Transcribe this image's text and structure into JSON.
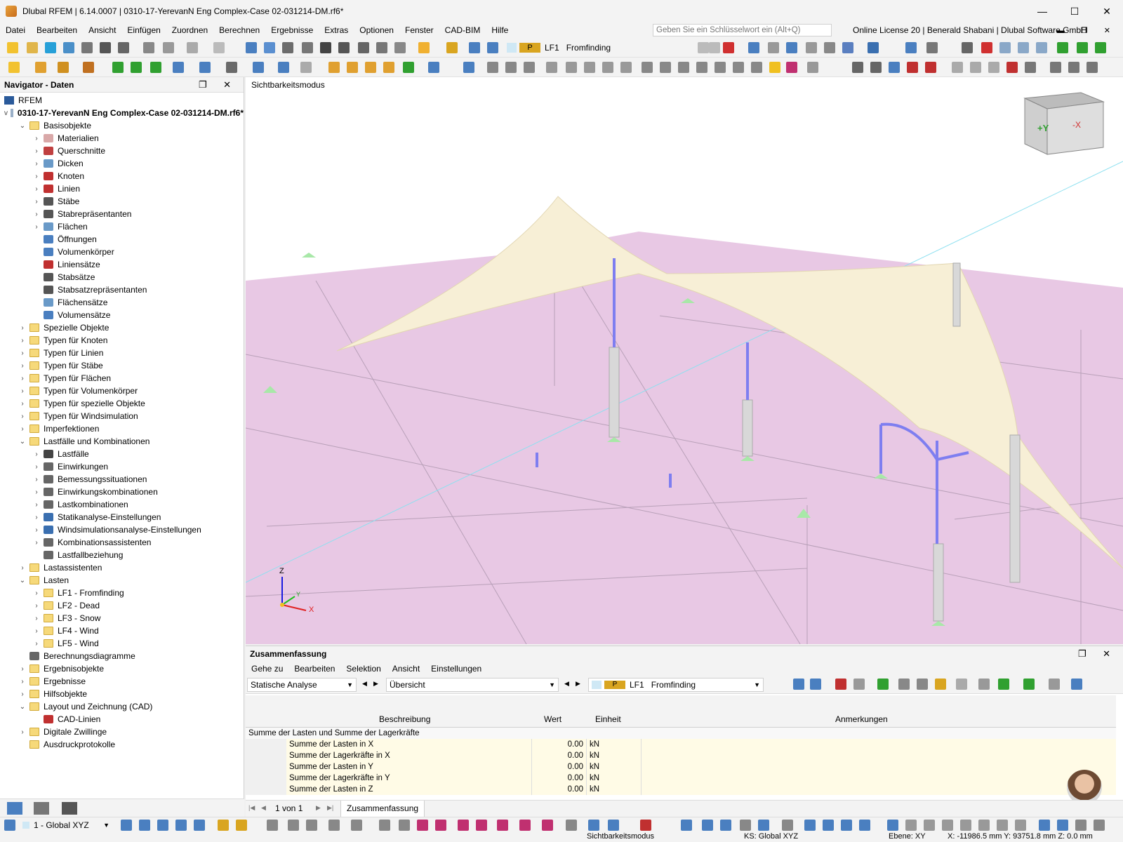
{
  "window": {
    "title": "Dlubal RFEM | 6.14.0007 | 0310-17-YerevanN Eng Complex-Case 02-031214-DM.rf6*",
    "buttons": [
      "—",
      "☐",
      "✕"
    ]
  },
  "menu": {
    "items": [
      "Datei",
      "Bearbeiten",
      "Ansicht",
      "Einfügen",
      "Zuordnen",
      "Berechnen",
      "Ergebnisse",
      "Extras",
      "Optionen",
      "Fenster",
      "CAD-BIM",
      "Hilfe"
    ],
    "search_placeholder": "Geben Sie ein Schlüsselwort ein (Alt+Q)",
    "license": "Online License 20 | Benerald Shabani | Dlubal Software GmbH"
  },
  "toolbar": {
    "loadcase_badge": "P",
    "loadcase_id": "LF1",
    "loadcase_name": "Fromfinding"
  },
  "navigator": {
    "title": "Navigator - Daten",
    "root": "RFEM",
    "file": "0310-17-YerevanN Eng Complex-Case 02-031214-DM.rf6*",
    "items": [
      {
        "label": "Basisobjekte",
        "level": 1,
        "toggle": "v",
        "icon": "folder"
      },
      {
        "label": "Materialien",
        "level": 2,
        "toggle": ">",
        "icon": "material"
      },
      {
        "label": "Querschnitte",
        "level": 2,
        "toggle": ">",
        "icon": "section"
      },
      {
        "label": "Dicken",
        "level": 2,
        "toggle": ">",
        "icon": "thickness"
      },
      {
        "label": "Knoten",
        "level": 2,
        "toggle": ">",
        "icon": "node"
      },
      {
        "label": "Linien",
        "level": 2,
        "toggle": ">",
        "icon": "line"
      },
      {
        "label": "Stäbe",
        "level": 2,
        "toggle": ">",
        "icon": "member"
      },
      {
        "label": "Stabrepräsentanten",
        "level": 2,
        "toggle": ">",
        "icon": "member"
      },
      {
        "label": "Flächen",
        "level": 2,
        "toggle": ">",
        "icon": "surface"
      },
      {
        "label": "Öffnungen",
        "level": 2,
        "toggle": "",
        "icon": "opening"
      },
      {
        "label": "Volumenkörper",
        "level": 2,
        "toggle": "",
        "icon": "solid"
      },
      {
        "label": "Liniensätze",
        "level": 2,
        "toggle": "",
        "icon": "line"
      },
      {
        "label": "Stabsätze",
        "level": 2,
        "toggle": "",
        "icon": "member"
      },
      {
        "label": "Stabsatzrepräsentanten",
        "level": 2,
        "toggle": "",
        "icon": "member"
      },
      {
        "label": "Flächensätze",
        "level": 2,
        "toggle": "",
        "icon": "surface"
      },
      {
        "label": "Volumensätze",
        "level": 2,
        "toggle": "",
        "icon": "solid"
      },
      {
        "label": "Spezielle Objekte",
        "level": 1,
        "toggle": ">",
        "icon": "folder"
      },
      {
        "label": "Typen für Knoten",
        "level": 1,
        "toggle": ">",
        "icon": "folder"
      },
      {
        "label": "Typen für Linien",
        "level": 1,
        "toggle": ">",
        "icon": "folder"
      },
      {
        "label": "Typen für Stäbe",
        "level": 1,
        "toggle": ">",
        "icon": "folder"
      },
      {
        "label": "Typen für Flächen",
        "level": 1,
        "toggle": ">",
        "icon": "folder"
      },
      {
        "label": "Typen für Volumenkörper",
        "level": 1,
        "toggle": ">",
        "icon": "folder"
      },
      {
        "label": "Typen für spezielle Objekte",
        "level": 1,
        "toggle": ">",
        "icon": "folder"
      },
      {
        "label": "Typen für Windsimulation",
        "level": 1,
        "toggle": ">",
        "icon": "folder"
      },
      {
        "label": "Imperfektionen",
        "level": 1,
        "toggle": ">",
        "icon": "folder"
      },
      {
        "label": "Lastfälle und Kombinationen",
        "level": 1,
        "toggle": "v",
        "icon": "folder"
      },
      {
        "label": "Lastfälle",
        "level": 2,
        "toggle": ">",
        "icon": "loadcase"
      },
      {
        "label": "Einwirkungen",
        "level": 2,
        "toggle": ">",
        "icon": "combo"
      },
      {
        "label": "Bemessungssituationen",
        "level": 2,
        "toggle": ">",
        "icon": "combo"
      },
      {
        "label": "Einwirkungskombinationen",
        "level": 2,
        "toggle": ">",
        "icon": "combo"
      },
      {
        "label": "Lastkombinationen",
        "level": 2,
        "toggle": ">",
        "icon": "combo"
      },
      {
        "label": "Statikanalyse-Einstellungen",
        "level": 2,
        "toggle": ">",
        "icon": "settings"
      },
      {
        "label": "Windsimulationsanalyse-Einstellungen",
        "level": 2,
        "toggle": ">",
        "icon": "settings"
      },
      {
        "label": "Kombinationsassistenten",
        "level": 2,
        "toggle": ">",
        "icon": "combo"
      },
      {
        "label": "Lastfallbeziehung",
        "level": 2,
        "toggle": "",
        "icon": "combo"
      },
      {
        "label": "Lastassistenten",
        "level": 1,
        "toggle": ">",
        "icon": "folder"
      },
      {
        "label": "Lasten",
        "level": 1,
        "toggle": "v",
        "icon": "folder"
      },
      {
        "label": "LF1 - Fromfinding",
        "level": 2,
        "toggle": ">",
        "icon": "folder"
      },
      {
        "label": "LF2 - Dead",
        "level": 2,
        "toggle": ">",
        "icon": "folder"
      },
      {
        "label": "LF3 - Snow",
        "level": 2,
        "toggle": ">",
        "icon": "folder"
      },
      {
        "label": "LF4 - Wind",
        "level": 2,
        "toggle": ">",
        "icon": "folder"
      },
      {
        "label": "LF5 - Wind",
        "level": 2,
        "toggle": ">",
        "icon": "folder"
      },
      {
        "label": "Berechnungsdiagramme",
        "level": 1,
        "toggle": "",
        "icon": "diagram"
      },
      {
        "label": "Ergebnisobjekte",
        "level": 1,
        "toggle": ">",
        "icon": "folder"
      },
      {
        "label": "Ergebnisse",
        "level": 1,
        "toggle": ">",
        "icon": "folder"
      },
      {
        "label": "Hilfsobjekte",
        "level": 1,
        "toggle": ">",
        "icon": "folder"
      },
      {
        "label": "Layout und Zeichnung (CAD)",
        "level": 1,
        "toggle": "v",
        "icon": "folder"
      },
      {
        "label": "CAD-Linien",
        "level": 2,
        "toggle": "",
        "icon": "line"
      },
      {
        "label": "Digitale Zwillinge",
        "level": 1,
        "toggle": ">",
        "icon": "folder"
      },
      {
        "label": "Ausdruckprotokolle",
        "level": 1,
        "toggle": "",
        "icon": "folder"
      }
    ]
  },
  "viewport": {
    "mode_label": "Sichtbarkeitsmodus",
    "cube_labels": {
      "front": "+Y",
      "side": "-X"
    },
    "axes": {
      "z": "Z",
      "y": "Y",
      "x": "X"
    }
  },
  "summary": {
    "title": "Zusammenfassung",
    "menu": [
      "Gehe zu",
      "Bearbeiten",
      "Selektion",
      "Ansicht",
      "Einstellungen"
    ],
    "analysis_combo": "Statische Analyse",
    "overview_combo": "Übersicht",
    "lc_badge": "P",
    "lc_id": "LF1",
    "lc_name": "Fromfinding",
    "columns": [
      "Beschreibung",
      "Wert",
      "Einheit",
      "Anmerkungen"
    ],
    "group": "Summe der Lasten und Summe der Lagerkräfte",
    "rows": [
      {
        "desc": "Summe der Lasten in X",
        "value": "0.00",
        "unit": "kN"
      },
      {
        "desc": "Summe der Lagerkräfte in X",
        "value": "0.00",
        "unit": "kN"
      },
      {
        "desc": "Summe der Lasten in Y",
        "value": "0.00",
        "unit": "kN"
      },
      {
        "desc": "Summe der Lagerkräfte in Y",
        "value": "0.00",
        "unit": "kN"
      },
      {
        "desc": "Summe der Lasten in Z",
        "value": "0.00",
        "unit": "kN"
      }
    ],
    "pager": "1 von 1",
    "tab": "Zusammenfassung"
  },
  "bottom": {
    "coord_system": "1 - Global XYZ"
  },
  "status": {
    "mode": "Sichtbarkeitsmodus",
    "cs": "KS: Global XYZ",
    "plane": "Ebene: XY",
    "coords": "X: -11986.5 mm  Y: 93751.8 mm  Z: 0.0 mm"
  },
  "colors": {
    "membrane": "#f7efd6",
    "floor": "#e8c8e4",
    "member": "#7e7ef0",
    "support": "#a8e8a8"
  }
}
